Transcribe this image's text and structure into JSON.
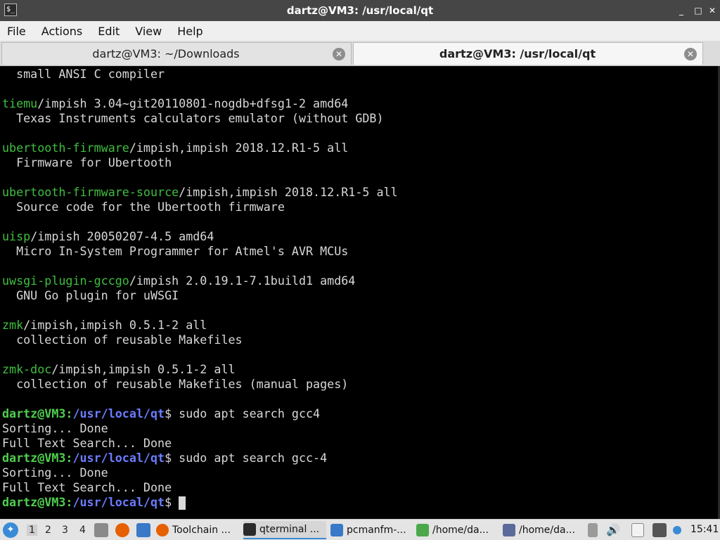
{
  "window": {
    "title": "dartz@VM3: /usr/local/qt",
    "icon_glyph": "$_",
    "minimize": "_",
    "maximize": "□",
    "close": "✕"
  },
  "menu": [
    "File",
    "Actions",
    "Edit",
    "View",
    "Help"
  ],
  "tabs": [
    {
      "label": "dartz@VM3: ~/Downloads",
      "close": "✕"
    },
    {
      "label": "dartz@VM3: /usr/local/qt",
      "close": "✕"
    }
  ],
  "terminal": {
    "lines": [
      {
        "text": "  small ANSI C compiler"
      },
      {
        "text": ""
      },
      {
        "pkg": "tiemu",
        "text": "/impish 3.04~git20110801-nogdb+dfsg1-2 amd64"
      },
      {
        "text": "  Texas Instruments calculators emulator (without GDB)"
      },
      {
        "text": ""
      },
      {
        "pkg": "ubertooth-firmware",
        "text": "/impish,impish 2018.12.R1-5 all"
      },
      {
        "text": "  Firmware for Ubertooth"
      },
      {
        "text": ""
      },
      {
        "pkg": "ubertooth-firmware-source",
        "text": "/impish,impish 2018.12.R1-5 all"
      },
      {
        "text": "  Source code for the Ubertooth firmware"
      },
      {
        "text": ""
      },
      {
        "pkg": "uisp",
        "text": "/impish 20050207-4.5 amd64"
      },
      {
        "text": "  Micro In-System Programmer for Atmel's AVR MCUs"
      },
      {
        "text": ""
      },
      {
        "pkg": "uwsgi-plugin-gccgo",
        "text": "/impish 2.0.19.1-7.1build1 amd64"
      },
      {
        "text": "  GNU Go plugin for uWSGI"
      },
      {
        "text": ""
      },
      {
        "pkg": "zmk",
        "text": "/impish,impish 0.5.1-2 all"
      },
      {
        "text": "  collection of reusable Makefiles"
      },
      {
        "text": ""
      },
      {
        "pkg": "zmk-doc",
        "text": "/impish,impish 0.5.1-2 all"
      },
      {
        "text": "  collection of reusable Makefiles (manual pages)"
      },
      {
        "text": ""
      },
      {
        "user": "dartz@VM3",
        "path": "/usr/local/qt",
        "text": "$ sudo apt search gcc4"
      },
      {
        "text": "Sorting... Done"
      },
      {
        "text": "Full Text Search... Done"
      },
      {
        "user": "dartz@VM3",
        "path": "/usr/local/qt",
        "text": "$ sudo apt search gcc-4"
      },
      {
        "text": "Sorting... Done"
      },
      {
        "text": "Full Text Search... Done"
      },
      {
        "user": "dartz@VM3",
        "path": "/usr/local/qt",
        "text": "$ ",
        "cursor": true
      }
    ]
  },
  "taskbar": {
    "workspaces": [
      "1",
      "2",
      "3",
      "4"
    ],
    "tasks": [
      {
        "label": "Toolchain ...",
        "icon": "firefox-icon",
        "color": "#e66000"
      },
      {
        "label": "qterminal ...",
        "icon": "terminal-icon",
        "color": "#2b2b2b"
      },
      {
        "label": "pcmanfm-...",
        "icon": "folder-icon",
        "color": "#3a78c8"
      },
      {
        "label": "/home/da...",
        "icon": "text-editor-icon",
        "color": "#4aa84a"
      },
      {
        "label": "/home/da...",
        "icon": "featherpad-icon",
        "color": "#5a6a9a"
      }
    ],
    "clock": "15:41",
    "colors": {
      "accent": "#3a8bd6",
      "pkg_green": "#3fbf3f",
      "path_blue": "#6b7cff"
    }
  }
}
